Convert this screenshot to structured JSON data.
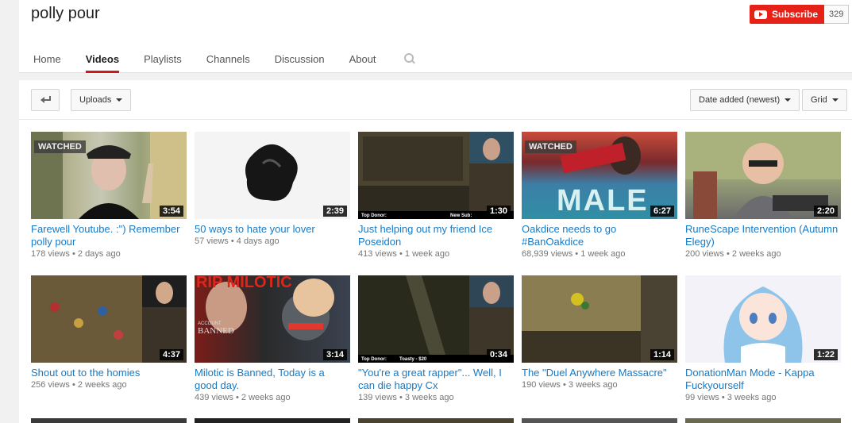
{
  "channel": {
    "title": "polly pour"
  },
  "subscribe": {
    "label": "Subscribe",
    "count": "329"
  },
  "tabs": [
    {
      "label": "Home"
    },
    {
      "label": "Videos"
    },
    {
      "label": "Playlists"
    },
    {
      "label": "Channels"
    },
    {
      "label": "Discussion"
    },
    {
      "label": "About"
    }
  ],
  "toolbar": {
    "uploads_label": "Uploads",
    "sort_label": "Date added (newest)",
    "view_label": "Grid"
  },
  "videos": [
    {
      "title": "Farewell Youtube. :\") Remember polly pour",
      "views": "178 views",
      "age": "2 days ago",
      "duration": "3:54",
      "watched": "WATCHED"
    },
    {
      "title": "50 ways to hate your lover",
      "views": "57 views",
      "age": "4 days ago",
      "duration": "2:39"
    },
    {
      "title": "Just helping out my friend Ice Poseidon",
      "views": "413 views",
      "age": "1 week ago",
      "duration": "1:30",
      "overlay_left": "Top Donor:",
      "overlay_right": "New Sub:"
    },
    {
      "title": "Oakdice needs to go #BanOakdice",
      "views": "68,939 views",
      "age": "1 week ago",
      "duration": "6:27",
      "watched": "WATCHED",
      "overlay_text": "MALE"
    },
    {
      "title": "RuneScape Intervention (Autumn Elegy)",
      "views": "200 views",
      "age": "2 weeks ago",
      "duration": "2:20"
    },
    {
      "title": "Shout out to the homies",
      "views": "256 views",
      "age": "2 weeks ago",
      "duration": "4:37"
    },
    {
      "title": "Milotic is Banned, Today is a good day.",
      "views": "439 views",
      "age": "2 weeks ago",
      "duration": "3:14",
      "overlay_text": "RIP MILOTIC",
      "overlay_sub1": "ACCOUNT",
      "overlay_sub2": "BANNED"
    },
    {
      "title": "\"You're a great rapper\"... Well, I can die happy Cx",
      "views": "139 views",
      "age": "3 weeks ago",
      "duration": "0:34",
      "overlay_left": "Top Donor:",
      "overlay_mid": "Toasty - $20"
    },
    {
      "title": "The \"Duel Anywhere Massacre\"",
      "views": "190 views",
      "age": "3 weeks ago",
      "duration": "1:14"
    },
    {
      "title": "DonationMan Mode - Kappa Fuckyourself",
      "views": "99 views",
      "age": "3 weeks ago",
      "duration": "1:22"
    }
  ]
}
